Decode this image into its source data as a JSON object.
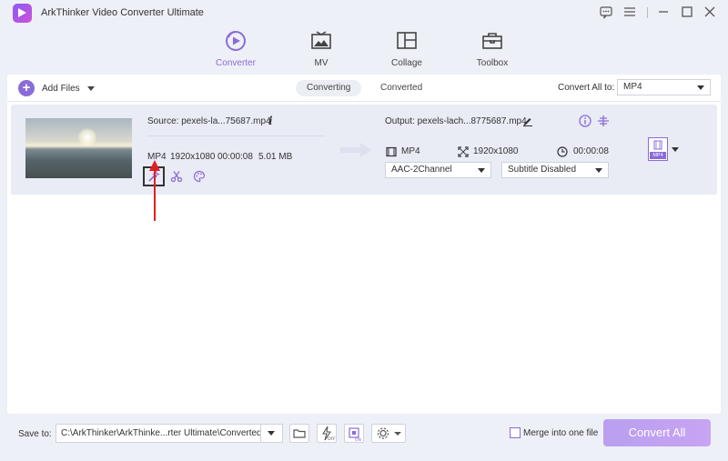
{
  "app": {
    "title": "ArkThinker Video Converter Ultimate"
  },
  "nav": [
    {
      "label": "Converter",
      "icon": "converter-icon",
      "active": true
    },
    {
      "label": "MV",
      "icon": "mv-icon"
    },
    {
      "label": "Collage",
      "icon": "collage-icon"
    },
    {
      "label": "Toolbox",
      "icon": "toolbox-icon"
    }
  ],
  "toolbar": {
    "add_files": "Add Files",
    "tabs": [
      "Converting",
      "Converted"
    ],
    "convert_all_to_label": "Convert All to:",
    "convert_all_to_value": "MP4"
  },
  "file": {
    "source": "Source: pexels-la...75687.mp4",
    "format": "MP4",
    "resolution": "1920x1080",
    "duration": "00:00:08",
    "size": "5.01 MB",
    "output": "Output: pexels-lach...8775687.mp4",
    "out_format": "MP4",
    "out_resolution": "1920x1080",
    "out_duration": "00:00:08",
    "audio": "AAC-2Channel",
    "subtitle": "Subtitle Disabled",
    "badge": "MP4"
  },
  "bottom": {
    "save_to_label": "Save to:",
    "path": "C:\\ArkThinker\\ArkThinke...rter Ultimate\\Converted",
    "merge_label": "Merge into one file",
    "convert_all": "Convert All"
  },
  "colors": {
    "accent": "#8b6bd9",
    "annotation_arrow": "#e02020"
  }
}
